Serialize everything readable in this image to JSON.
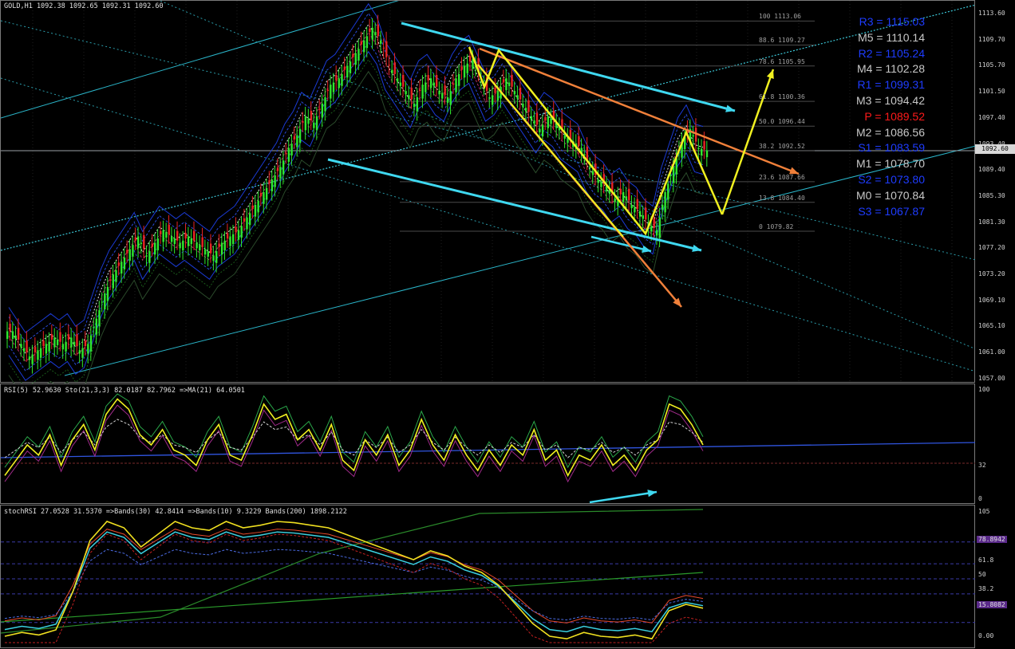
{
  "header": {
    "main": "GOLD,H1  1092.38 1092.65 1092.31 1092.60",
    "rsi": "RSI(5) 52.9630  Sto(21,3,3) 82.0187 82.7962  =>MA(21) 64.0501",
    "stochrsi": "stochRSI 27.0528 31.5370  =>Bands(30) 42.8414  =>Bands(10) 9.3229  Bands(200) 1898.2122"
  },
  "current_price": "1092.60",
  "pivots": [
    {
      "label": "R3 = 1115.03",
      "color": "#1e3cff"
    },
    {
      "label": "M5 = 1110.14",
      "color": "#c8c8c8"
    },
    {
      "label": "R2 = 1105.24",
      "color": "#1e3cff"
    },
    {
      "label": "M4 = 1102.28",
      "color": "#c8c8c8"
    },
    {
      "label": "R1 = 1099.31",
      "color": "#1e3cff"
    },
    {
      "label": "M3 = 1094.42",
      "color": "#c8c8c8"
    },
    {
      "label": "P   = 1089.52",
      "color": "#ff1a1a"
    },
    {
      "label": "M2 = 1086.56",
      "color": "#c8c8c8"
    },
    {
      "label": "S1 = 1083.59",
      "color": "#1e3cff"
    },
    {
      "label": "M1 = 1078.70",
      "color": "#c8c8c8"
    },
    {
      "label": "S2 = 1073.80",
      "color": "#1e3cff"
    },
    {
      "label": "M0 = 1070.84",
      "color": "#c8c8c8"
    },
    {
      "label": "S3 = 1067.87",
      "color": "#1e3cff"
    }
  ],
  "fib_levels": [
    "100 1113.06",
    "88.6 1109.27",
    "78.6 1105.95",
    "61.8 1100.36",
    "50.0 1096.44",
    "38.2 1092.52",
    "23.6 1087.66",
    "13.8 1084.40",
    "0 1079.82"
  ],
  "axes": {
    "main": [
      "1113.60",
      "1109.70",
      "1105.70",
      "1101.50",
      "1097.40",
      "1093.40",
      "1089.40",
      "1085.30",
      "1081.30",
      "1077.20",
      "1073.20",
      "1069.10",
      "1065.10",
      "1061.00",
      "1057.00"
    ],
    "rsi": [
      "100",
      "32",
      "0"
    ],
    "srsi": [
      "105",
      "61.8",
      "50",
      "38.2",
      "0.00"
    ],
    "srsi_boxes": [
      "78.8942",
      "15.8082"
    ]
  },
  "chart_data": {
    "type": "candlestick",
    "symbol": "GOLD",
    "timeframe": "H1",
    "ohlc_last": {
      "open": 1092.38,
      "high": 1092.65,
      "low": 1092.31,
      "close": 1092.6
    },
    "ylim": [
      1057.0,
      1115.0
    ],
    "close_path": [
      1064,
      1062,
      1060,
      1061,
      1062,
      1063,
      1062,
      1063,
      1061,
      1062,
      1066,
      1070,
      1073,
      1075,
      1077,
      1079,
      1076,
      1078,
      1080,
      1079,
      1078,
      1079,
      1078,
      1077,
      1076,
      1078,
      1079,
      1080,
      1082,
      1084,
      1086,
      1088,
      1090,
      1093,
      1095,
      1098,
      1097,
      1100,
      1103,
      1104,
      1106,
      1108,
      1110,
      1112,
      1110,
      1106,
      1104,
      1102,
      1100,
      1103,
      1104,
      1102,
      1101,
      1104,
      1106,
      1107,
      1104,
      1101,
      1102,
      1104,
      1102,
      1100,
      1098,
      1096,
      1098,
      1097,
      1095,
      1094,
      1093,
      1090,
      1088,
      1087,
      1085,
      1086,
      1084,
      1083,
      1081,
      1080,
      1086,
      1090,
      1094,
      1096,
      1093,
      1092.6
    ],
    "fibonacci": [
      {
        "level": 100,
        "price": 1113.06
      },
      {
        "level": 88.6,
        "price": 1109.27
      },
      {
        "level": 78.6,
        "price": 1105.95
      },
      {
        "level": 61.8,
        "price": 1100.36
      },
      {
        "level": 50.0,
        "price": 1096.44
      },
      {
        "level": 38.2,
        "price": 1092.52
      },
      {
        "level": 23.6,
        "price": 1087.66
      },
      {
        "level": 13.8,
        "price": 1084.4
      },
      {
        "level": 0,
        "price": 1079.82
      }
    ],
    "pivot_levels": {
      "R3": 1115.03,
      "M5": 1110.14,
      "R2": 1105.24,
      "M4": 1102.28,
      "R1": 1099.31,
      "M3": 1094.42,
      "P": 1089.52,
      "M2": 1086.56,
      "S1": 1083.59,
      "M1": 1078.7,
      "S2": 1073.8,
      "M0": 1070.84,
      "S3": 1067.87
    },
    "rsi_values": [
      20,
      35,
      50,
      40,
      60,
      30,
      55,
      70,
      45,
      80,
      95,
      85,
      60,
      50,
      65,
      45,
      40,
      30,
      55,
      70,
      40,
      35,
      60,
      90,
      75,
      80,
      55,
      65,
      45,
      70,
      35,
      25,
      55,
      40,
      60,
      30,
      45,
      75,
      50,
      35,
      60,
      40,
      25,
      45,
      30,
      50,
      40,
      65,
      35,
      45,
      20,
      40,
      35,
      50,
      30,
      40,
      25,
      45,
      55,
      90,
      85,
      70,
      50
    ],
    "stochrsi_values": [
      5,
      8,
      6,
      10,
      40,
      80,
      95,
      90,
      75,
      85,
      95,
      90,
      88,
      95,
      90,
      92,
      95,
      94,
      92,
      90,
      85,
      80,
      75,
      70,
      65,
      72,
      68,
      60,
      55,
      45,
      30,
      15,
      5,
      3,
      8,
      5,
      4,
      6,
      3,
      25,
      30,
      27
    ]
  }
}
